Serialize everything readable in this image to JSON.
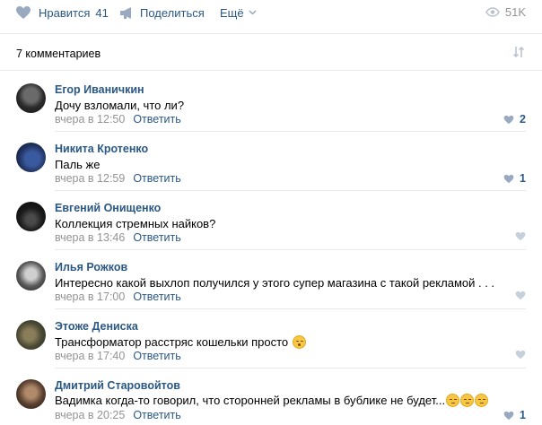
{
  "actions": {
    "like_label": "Нравится",
    "like_count": "41",
    "share_label": "Поделиться",
    "more_label": "Ещё",
    "views_count": "51K"
  },
  "comments_header": {
    "title": "7 комментариев"
  },
  "comments": [
    {
      "author": "Егор Иваничкин",
      "text": "Дочу взломали, что ли?",
      "time": "вчера в 12:50",
      "reply": "Ответить",
      "likes": "2",
      "liked_state": "active"
    },
    {
      "author": "Никита Кротенко",
      "text": "Паль же",
      "time": "вчера в 12:59",
      "reply": "Ответить",
      "likes": "1",
      "liked_state": "active"
    },
    {
      "author": "Евгений Онищенко",
      "text": "Коллекция стремных найков?",
      "time": "вчера в 13:46",
      "reply": "Ответить",
      "likes": "",
      "liked_state": "inactive"
    },
    {
      "author": "Илья Рожков",
      "text": "Интересно какой выхлоп получился у этого супер магазина с такой рекламой . . .",
      "time": "вчера в 17:00",
      "reply": "Ответить",
      "likes": "",
      "liked_state": "inactive"
    },
    {
      "author": "Этоже Дениска",
      "text": "Трансформатор расстряс кошельки просто",
      "time": "вчера в 17:40",
      "reply": "Ответить",
      "likes": "",
      "liked_state": "inactive"
    },
    {
      "author": "Дмитрий Старовойтов",
      "text": "Вадимка когда-то говорил, что сторонней рекламы в бублике не будет...",
      "time": "вчера в 20:25",
      "reply": "Ответить",
      "likes": "1",
      "liked_state": "active"
    }
  ],
  "colors": {
    "link": "#2a5885",
    "meta": "#939393",
    "divider": "#e7e8ec",
    "like_inactive": "#b3c4d8"
  },
  "icons": {
    "like": "heart-icon",
    "share": "megaphone-icon",
    "more": "chevron-down-icon",
    "views": "eye-icon",
    "sort": "sort-arrows-icon",
    "emoji_blush": "flushed-face-emoji",
    "emoji_sad": "pensive-face-emoji"
  }
}
